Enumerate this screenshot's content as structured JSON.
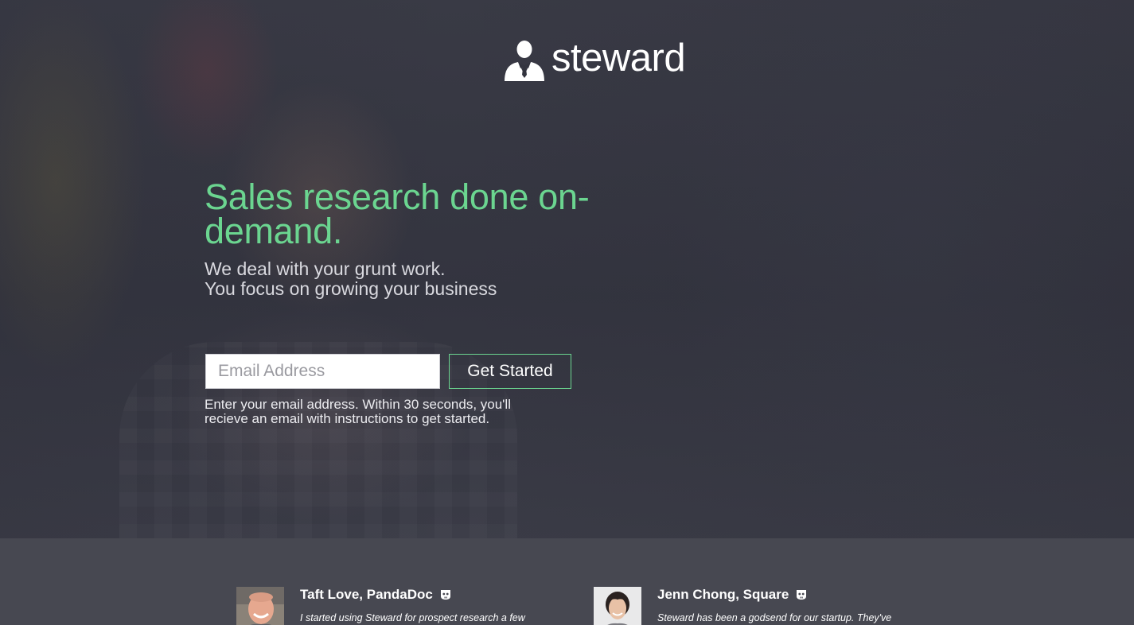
{
  "brand": {
    "name": "steward",
    "logo_icon": "businessman-icon"
  },
  "hero": {
    "headline": "Sales research done on-demand.",
    "subhead_line1": "We deal with your grunt work.",
    "subhead_line2": "You focus on growing your business",
    "email_placeholder": "Email Address",
    "cta_label": "Get Started",
    "hint_line1": "Enter your email address. Within 30 seconds, you'll",
    "hint_line2": "recieve an email with instructions to get started.",
    "accent_color": "#6bd590"
  },
  "testimonials": [
    {
      "name": "Taft Love, PandaDoc",
      "quote": "I started using Steward for prospect research a few",
      "badge_icon": "ghost-icon"
    },
    {
      "name": "Jenn Chong, Square",
      "quote": "Steward has been a godsend for our startup. They've",
      "badge_icon": "ghost-icon"
    }
  ]
}
